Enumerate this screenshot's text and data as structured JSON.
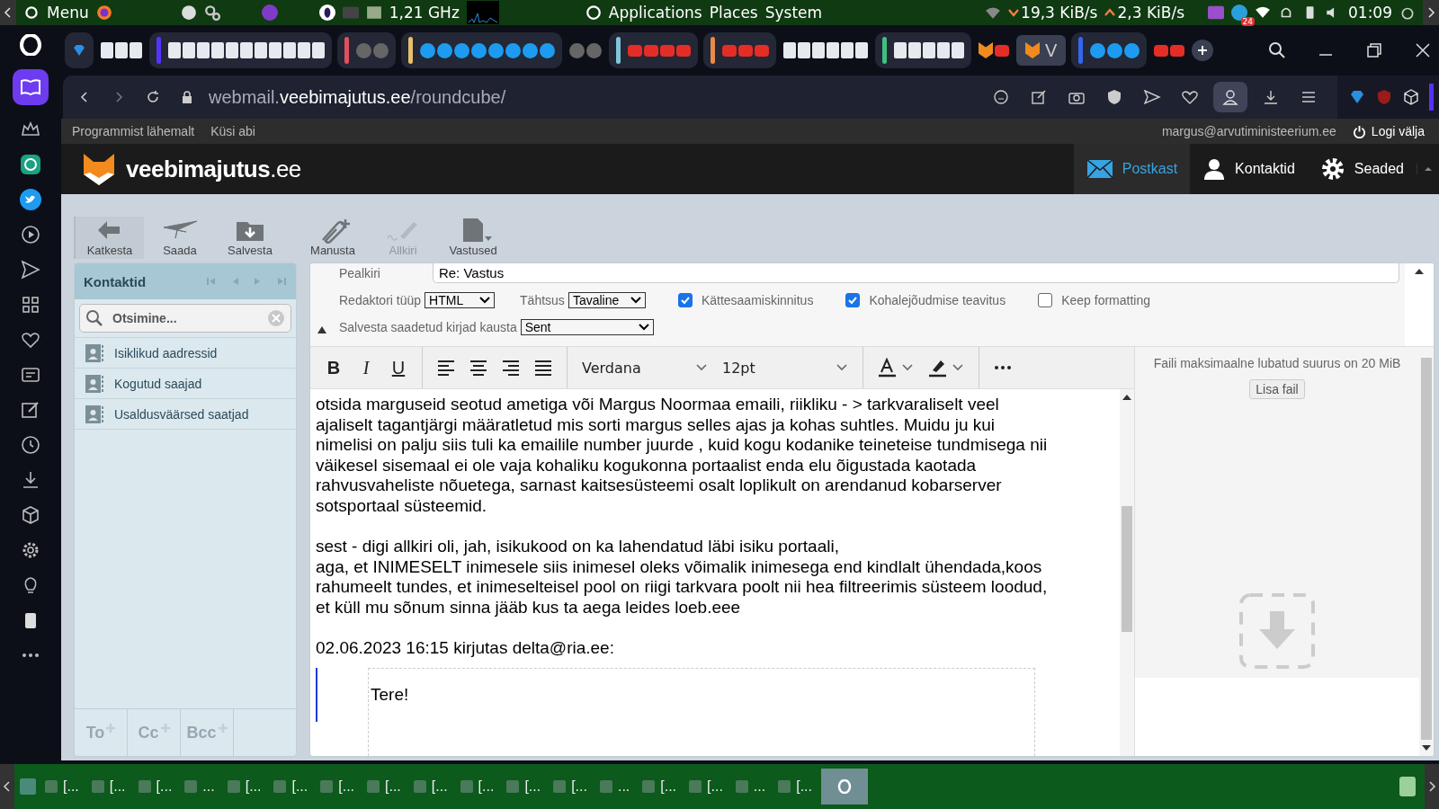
{
  "system_bar": {
    "menu": "Menu",
    "cpu": "1,21 GHz",
    "menus": [
      "Applications",
      "Places",
      "System"
    ],
    "net_down": "19,3 KiB/s",
    "net_up": "2,3 KiB/s",
    "telegram_badge": "24",
    "clock": "01:09"
  },
  "browser": {
    "tab_label": "V",
    "url": {
      "scheme_host_prefix": "webmail.",
      "host": "veebimajutus.ee",
      "path": "/roundcube/"
    }
  },
  "webmail": {
    "top_links": [
      "Programmist lähemalt",
      "Küsi abi"
    ],
    "user": "margus@arvutiministeerium.ee",
    "logout": "Logi välja",
    "logo": {
      "name": "veebimajutus",
      "suffix": ".ee"
    },
    "nav": [
      {
        "label": "Postkast",
        "selected": true
      },
      {
        "label": "Kontaktid",
        "selected": false
      },
      {
        "label": "Seaded",
        "selected": false
      }
    ],
    "toolbar": [
      {
        "label": "Katkesta",
        "disabled": false
      },
      {
        "label": "Saada",
        "disabled": false
      },
      {
        "label": "Salvesta",
        "disabled": false
      },
      {
        "label": "Manusta",
        "disabled": false
      },
      {
        "label": "Allkiri",
        "disabled": true
      },
      {
        "label": "Vastused",
        "disabled": false
      }
    ],
    "contacts": {
      "title": "Kontaktid",
      "search_placeholder": "Otsimine...",
      "items": [
        "Isiklikud aadressid",
        "Kogutud saajad",
        "Usaldusväärsed saatjad"
      ],
      "recipient_buttons": [
        "To",
        "Cc",
        "Bcc"
      ]
    },
    "compose": {
      "subject_label": "Pealkiri",
      "subject": "Re: Vastus",
      "editor_type_label": "Redaktori tüüp",
      "editor_type": "HTML",
      "priority_label": "Tähtsus",
      "priority": "Tavaline",
      "options": [
        {
          "label": "Kättesaamiskinnitus",
          "checked": true
        },
        {
          "label": "Kohalejõudmise teavitus",
          "checked": true
        },
        {
          "label": "Keep formatting",
          "checked": false
        }
      ],
      "save_folder_label": "Salvesta saadetud kirjad kausta",
      "save_folder": "Sent",
      "format_buttons": [
        "B",
        "I",
        "U"
      ],
      "font": "Verdana",
      "size": "12pt",
      "body_paragraphs": [
        [
          "otsida marguseid seotud ametiga või Margus Noormaa emaili, riikliku - > tarkvaraliselt veel",
          "ajaliselt tagantjärgi määratletud mis sorti margus selles ajas ja kohas suhtles. Muidu ju kui",
          "nimelisi on palju siis tuli ka emailile number juurde , kuid kogu kodanike teineteise tundmisega nii",
          "väikesel sisemaal ei ole vaja kohaliku kogukonna portaalist enda elu õigustada kaotada",
          "rahvusvaheliste nõuetega, sarnast kaitsesüsteemi osalt loplikult on arendanud kobarserver",
          "sotsportaal süsteemid."
        ],
        [
          "sest - digi allkiri oli, jah, isikukood on ka lahendatud läbi isiku portaali,",
          "aga, et INIMESELT inimesele siis inimesel oleks võimalik inimesega end kindlalt ühendada,koos",
          "rahumeelt tundes, et inimeselteisel pool on riigi tarkvara poolt nii hea filtreerimis süsteem loodud,",
          "et küll mu sõnum sinna jääb kus ta aega leides loeb.eee"
        ]
      ],
      "quote_header": "02.06.2023 16:15 kirjutas delta@ria.ee:",
      "quote_text": "Tere!",
      "attachment_limit": "Faili maksimaalne lubatud suurus on 20 MiB",
      "add_file": "Lisa fail"
    }
  },
  "taskbar": [
    "[...",
    "[...",
    "[...",
    "...",
    "[...",
    "[...",
    "[...",
    "[...",
    "[...",
    "[...",
    "[...",
    "[...",
    "...",
    "[...",
    "[...",
    "...",
    "[..."
  ]
}
